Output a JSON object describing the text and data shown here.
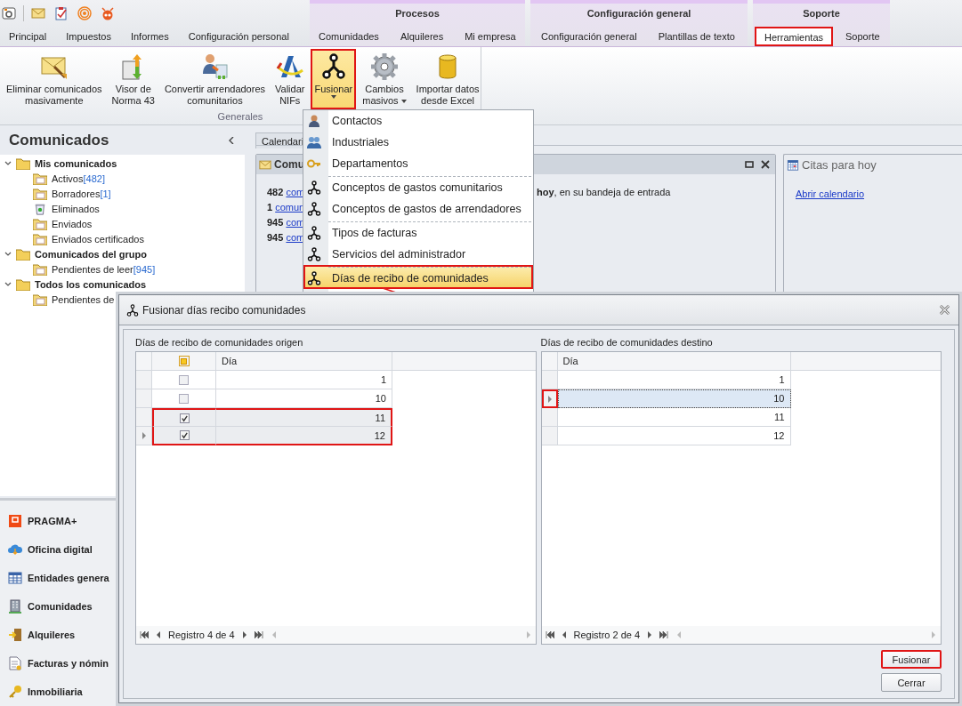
{
  "ribbon_tabs": {
    "ungrouped": [
      {
        "label": "Principal",
        "selected": false,
        "highlighted": false
      },
      {
        "label": "Impuestos",
        "selected": false,
        "highlighted": false
      },
      {
        "label": "Informes",
        "selected": false,
        "highlighted": false
      },
      {
        "label": "Configuración personal",
        "selected": false,
        "highlighted": false
      }
    ],
    "groups": [
      {
        "title": "Procesos",
        "tabs": [
          {
            "label": "Comunidades",
            "selected": false,
            "highlighted": false
          },
          {
            "label": "Alquileres",
            "selected": false,
            "highlighted": false
          },
          {
            "label": "Mi empresa",
            "selected": false,
            "highlighted": false
          }
        ]
      },
      {
        "title": "Configuración general",
        "tabs": [
          {
            "label": "Configuración general",
            "selected": false,
            "highlighted": false
          },
          {
            "label": "Plantillas de texto",
            "selected": false,
            "highlighted": false
          }
        ]
      },
      {
        "title": "Soporte",
        "tabs": [
          {
            "label": "Herramientas",
            "selected": true,
            "highlighted": true
          },
          {
            "label": "Soporte",
            "selected": false,
            "highlighted": false
          }
        ]
      }
    ]
  },
  "ribbon": {
    "group_label": "Generales",
    "buttons": [
      {
        "lines": [
          "Eliminar comunicados",
          "masivamente"
        ],
        "dropdown": false,
        "pressed": false,
        "highlighted": false
      },
      {
        "lines": [
          "Visor de",
          "Norma 43"
        ],
        "dropdown": false,
        "pressed": false,
        "highlighted": false
      },
      {
        "lines": [
          "Convertir arrendadores",
          "comunitarios"
        ],
        "dropdown": false,
        "pressed": false,
        "highlighted": false
      },
      {
        "lines": [
          "Validar",
          "NIFs"
        ],
        "dropdown": false,
        "pressed": false,
        "highlighted": false
      },
      {
        "lines": [
          "Fusionar"
        ],
        "dropdown": true,
        "pressed": true,
        "highlighted": true
      },
      {
        "lines": [
          "Cambios",
          "masivos"
        ],
        "dropdown": true,
        "pressed": false,
        "highlighted": false
      },
      {
        "lines": [
          "Importar datos",
          "desde Excel"
        ],
        "dropdown": false,
        "pressed": false,
        "highlighted": false
      }
    ]
  },
  "dropdown_menu": {
    "arrow": true,
    "items": [
      {
        "label": "Contactos",
        "separator_before": false,
        "selected": false,
        "highlighted": false
      },
      {
        "label": "Industriales",
        "separator_before": false,
        "selected": false,
        "highlighted": false
      },
      {
        "label": "Departamentos",
        "separator_before": false,
        "selected": false,
        "highlighted": false
      },
      {
        "label": "Conceptos de gastos comunitarios",
        "separator_before": true,
        "selected": false,
        "highlighted": false
      },
      {
        "label": "Conceptos de gastos de arrendadores",
        "separator_before": false,
        "selected": false,
        "highlighted": false
      },
      {
        "label": "Tipos de facturas",
        "separator_before": true,
        "selected": false,
        "highlighted": false
      },
      {
        "label": "Servicios del administrador",
        "separator_before": false,
        "selected": false,
        "highlighted": false
      },
      {
        "label": "Días de recibo de comunidades",
        "separator_before": true,
        "selected": true,
        "highlighted": true
      }
    ]
  },
  "sidebar": {
    "title": "Comunicados",
    "tree": [
      {
        "label": "Mis comunicados",
        "expanded": true,
        "children": [
          {
            "label": "Activos",
            "count": "[482]"
          },
          {
            "label": "Borradores",
            "count": "[1]"
          },
          {
            "label": "Eliminados"
          },
          {
            "label": "Enviados"
          },
          {
            "label": "Enviados certificados"
          }
        ]
      },
      {
        "label": "Comunicados del grupo",
        "expanded": true,
        "children": [
          {
            "label": "Pendientes de leer",
            "count": "[945]"
          }
        ]
      },
      {
        "label": "Todos los comunicados",
        "expanded": true,
        "children": [
          {
            "label": "Pendientes de"
          }
        ]
      }
    ],
    "nav_items": [
      {
        "label": "PRAGMA+"
      },
      {
        "label": "Oficina digital"
      },
      {
        "label": "Entidades genera"
      },
      {
        "label": "Comunidades"
      },
      {
        "label": "Alquileres"
      },
      {
        "label": "Facturas y nómin"
      },
      {
        "label": "Inmobiliaria"
      }
    ]
  },
  "documents": {
    "tab": "Calendari",
    "panel": {
      "title": "Comu",
      "lines": [
        {
          "count": "482",
          "link": "com",
          "tail": "**hoy**, en su bandeja de entrada"
        },
        {
          "count": "1",
          "link": "comun"
        },
        {
          "count": "945",
          "link": "com"
        },
        {
          "count": "945",
          "link": "com"
        }
      ]
    }
  },
  "citas_panel": {
    "title": "Citas para hoy",
    "link": "Abrir calendario"
  },
  "dialog": {
    "title": "Fusionar días recibo comunidades",
    "source": {
      "label": "Días de recibo de comunidades origen",
      "column": "Día",
      "select_all": {
        "checked": false,
        "indeterminate": true
      },
      "navigator": "Registro 4 de 4",
      "rows": [
        {
          "value": "1",
          "checked": false,
          "selected": false,
          "current": false,
          "highlighted": false
        },
        {
          "value": "10",
          "checked": false,
          "selected": false,
          "current": false,
          "highlighted": false
        },
        {
          "value": "11",
          "checked": true,
          "selected": true,
          "current": false,
          "highlighted": true
        },
        {
          "value": "12",
          "checked": true,
          "selected": true,
          "current": true,
          "highlighted": true
        }
      ]
    },
    "target": {
      "label": "Días de recibo de comunidades destino",
      "column": "Día",
      "navigator": "Registro 2 de 4",
      "rows": [
        {
          "value": "1",
          "current": false,
          "highlighted": false
        },
        {
          "value": "10",
          "current": true,
          "highlighted": true
        },
        {
          "value": "11",
          "current": false,
          "highlighted": false
        },
        {
          "value": "12",
          "current": false,
          "highlighted": false
        }
      ]
    },
    "buttons": [
      {
        "label": "Fusionar",
        "highlighted": true
      },
      {
        "label": "Cerrar",
        "highlighted": false
      }
    ]
  }
}
